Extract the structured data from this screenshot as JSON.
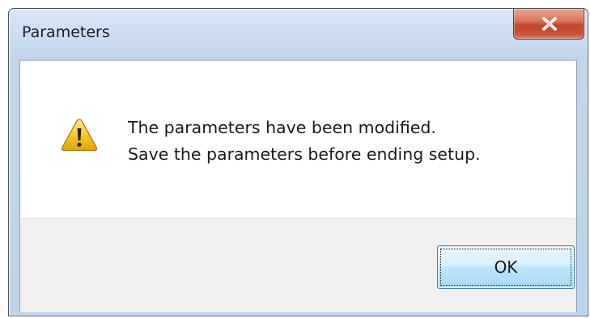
{
  "dialog": {
    "title": "Parameters",
    "close_icon": "close-x-icon",
    "message_icon": "warning-icon",
    "message_lines": [
      "The parameters have been modified.",
      "Save the parameters before ending setup."
    ],
    "ok_label": "OK"
  },
  "colors": {
    "close_button": "#c7462d",
    "ok_button_border": "#3c7fb1",
    "footer_bg": "#f0f0f0",
    "warning_fill": "#f3c11c"
  }
}
